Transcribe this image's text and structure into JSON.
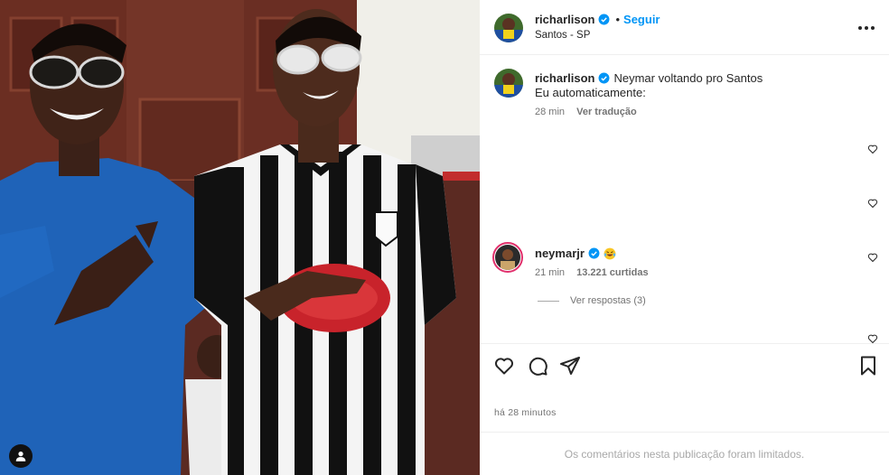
{
  "post": {
    "author": "richarlison",
    "follow_label": "Seguir",
    "separator": "•",
    "location": "Santos - SP",
    "more_icon": "more-horizontal-icon"
  },
  "caption": {
    "author": "richarlison",
    "line1": "Neymar voltando pro Santos",
    "line2": "Eu automaticamente:",
    "time": "28 min",
    "translate": "Ver tradução"
  },
  "comment": {
    "author": "neymarjr",
    "emoji": "laughing-with-tears-emoji",
    "time": "21 min",
    "likes": "13.221 curtidas",
    "replies": "Ver respostas (3)"
  },
  "actions": {
    "like_icon": "heart-icon",
    "comment_icon": "comment-icon",
    "share_icon": "send-icon",
    "save_icon": "bookmark-icon"
  },
  "footer": {
    "time_ago": "há 28 minutos",
    "limited_notice": "Os comentários nesta publicação foram limitados."
  },
  "colors": {
    "accent": "#0095f6",
    "verified": "#0095f6",
    "muted": "#737373",
    "border": "#efefef"
  }
}
